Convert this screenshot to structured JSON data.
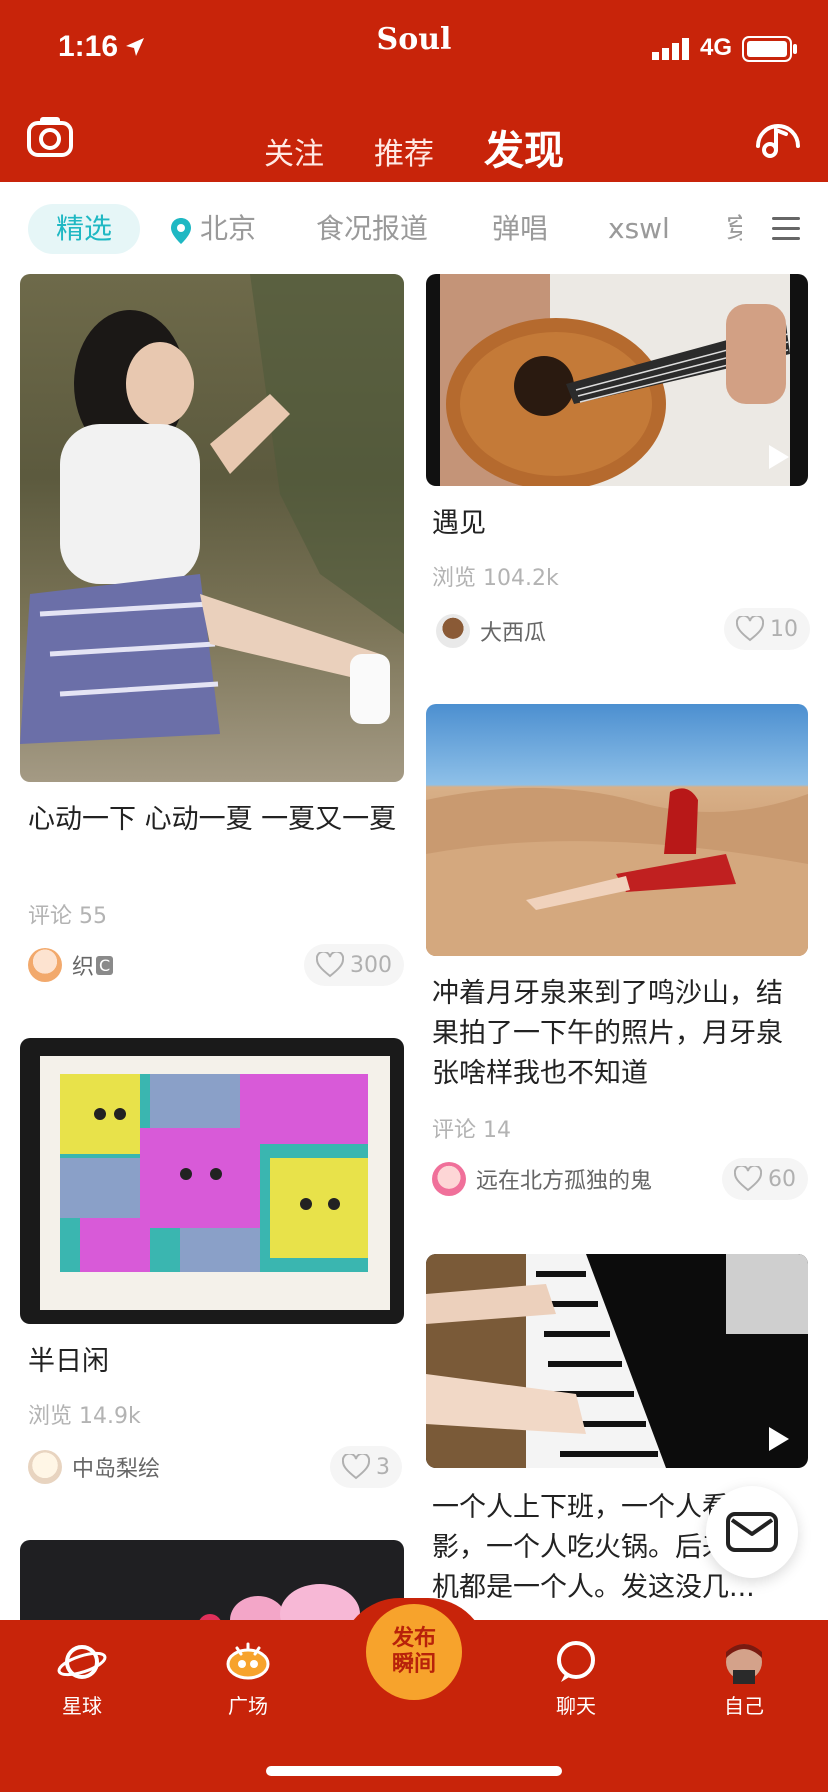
{
  "status": {
    "time": "1:16",
    "app_name": "Soul",
    "network": "4G"
  },
  "nav": {
    "tabs": [
      "关注",
      "推荐",
      "发现"
    ],
    "active": "发现"
  },
  "categories": [
    "精选",
    "北京",
    "食况报道",
    "弹唱",
    "xswl",
    "穿"
  ],
  "feed": {
    "left": [
      {
        "title": "心动一下 心动一夏 一夏又一夏",
        "meta": "评论 55",
        "author": "织",
        "author_badge": "C",
        "likes": "300"
      },
      {
        "title": "半日闲",
        "meta": "浏览 14.9k",
        "author": "中岛梨绘",
        "likes": "3"
      }
    ],
    "right": [
      {
        "title": "遇见",
        "meta": "浏览 104.2k",
        "author": "大西瓜",
        "likes": "10"
      },
      {
        "title": "冲着月牙泉来到了鸣沙山，结果拍了一下午的照片，月牙泉张啥样我也不知道",
        "meta": "评论 14",
        "author": "远在北方孤独的鬼",
        "likes": "60"
      },
      {
        "title": "一个人上下班，一个人看电影，一个人吃火锅。后来连手机都是一个人。发这没几..."
      }
    ]
  },
  "tabbar": {
    "planet": "星球",
    "square": "广场",
    "publish": "发布瞬间",
    "chat": "聊天",
    "me": "自己"
  },
  "colors": {
    "brand": "#c8240a",
    "accent": "#1fb8c3",
    "publish": "#f7a32c"
  }
}
